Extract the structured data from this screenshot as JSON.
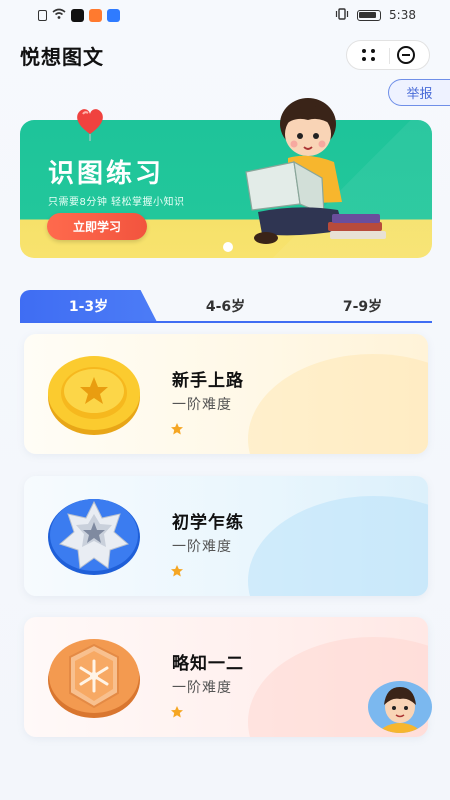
{
  "status_bar": {
    "time": "5:38",
    "signal_icons": [
      "sim-icon",
      "wifi-icon",
      "tiktok-icon",
      "video-icon",
      "browser-icon"
    ]
  },
  "header": {
    "app_title": "悦想图文"
  },
  "report_label": "举报",
  "banner": {
    "title": "识图练习",
    "subtitle": "只需要8分钟 轻松掌握小知识",
    "cta_label": "立即学习"
  },
  "tabs": [
    {
      "label": "1-3岁",
      "active": true
    },
    {
      "label": "4-6岁",
      "active": false
    },
    {
      "label": "7-9岁",
      "active": false
    }
  ],
  "levels": [
    {
      "title": "新手上路",
      "difficulty": "一阶难度",
      "stars": 1,
      "medal": "gold-star-medal-icon"
    },
    {
      "title": "初学乍练",
      "difficulty": "一阶难度",
      "stars": 1,
      "medal": "blue-star-badge-icon"
    },
    {
      "title": "略知一二",
      "difficulty": "一阶难度",
      "stars": 1,
      "medal": "orange-hexagon-medal-icon"
    }
  ],
  "colors": {
    "accent": "#3f6df3",
    "banner_green": "#1ec49a",
    "cta": "#f2543e",
    "star": "#f5a623"
  }
}
